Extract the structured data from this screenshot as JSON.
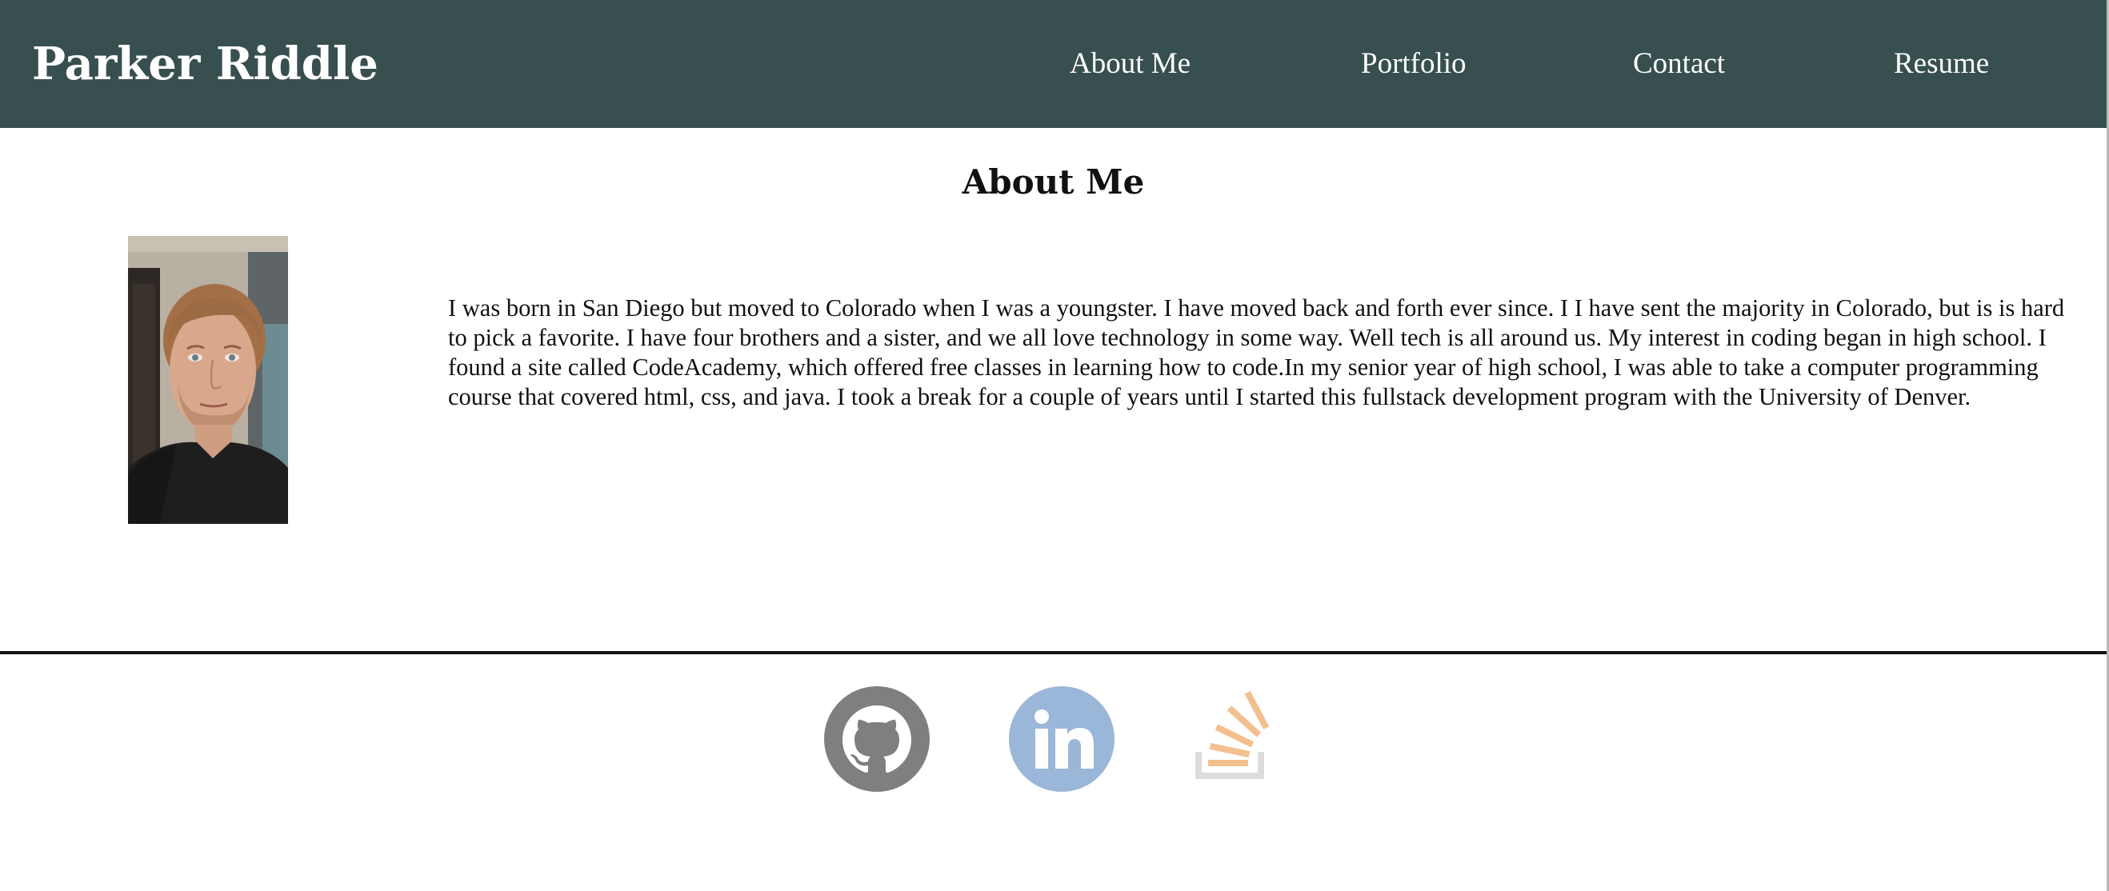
{
  "header": {
    "brand": "Parker Riddle",
    "nav": [
      {
        "label": "About Me"
      },
      {
        "label": "Portfolio"
      },
      {
        "label": "Contact"
      },
      {
        "label": "Resume"
      }
    ]
  },
  "about": {
    "title": "About Me",
    "bio": "I was born in San Diego but moved to Colorado when I was a youngster. I have moved back and forth ever since. I I have sent the majority in Colorado, but is is hard to pick a favorite. I have four brothers and a sister, and we all love technology in some way. Well tech is all around us. My interest in coding began in high school. I found a site called CodeAcademy, which offered free classes in learning how to code.In my senior year of high school, I was able to take a computer programming course that covered html, css, and java. I took a break for a couple of years until I started this fullstack development program with the University of Denver."
  },
  "footer": {
    "social": [
      {
        "icon": "github-icon",
        "color": "#7f7f7f"
      },
      {
        "icon": "linkedin-icon",
        "color": "#9ab6d8"
      },
      {
        "icon": "stack-overflow-icon",
        "color": "#f2c08f",
        "tray_color": "#dcdcdc"
      }
    ]
  },
  "colors": {
    "header_background": "#384f50",
    "header_text": "#ffffff",
    "body_text": "#111111",
    "divider": "#111111"
  }
}
